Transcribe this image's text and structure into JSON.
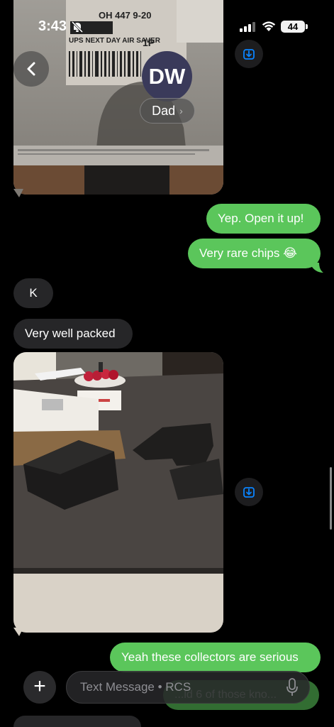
{
  "status_bar": {
    "time": "3:43",
    "battery": "44"
  },
  "header": {
    "avatar_initials": "DW",
    "contact_name": "Dad"
  },
  "messages": [
    {
      "id": "m1",
      "side": "sent",
      "text": "Yep. Open it up!"
    },
    {
      "id": "m2",
      "side": "sent",
      "text": "Very rare chips 😂"
    },
    {
      "id": "m3",
      "side": "received",
      "text": "K"
    },
    {
      "id": "m4",
      "side": "received",
      "text": "Very well packed"
    },
    {
      "id": "m5",
      "side": "sent",
      "text": "Yeah these collectors are serious"
    },
    {
      "id": "m6",
      "side": "sent",
      "text": "...ld 6 of those kno..."
    }
  ],
  "package_label": {
    "line1": "OH 447 9-20",
    "line2": "UPS NEXT DAY AIR SAVER",
    "line3": "1P"
  },
  "input": {
    "placeholder": "Text Message • RCS"
  },
  "icons": {
    "back": "chevron-left-icon",
    "save": "download-icon",
    "add": "plus-icon",
    "mic": "microphone-icon"
  },
  "colors": {
    "sent_bubble": "#5bc65b",
    "received_bubble": "#262628",
    "save_icon": "#0a84ff"
  }
}
